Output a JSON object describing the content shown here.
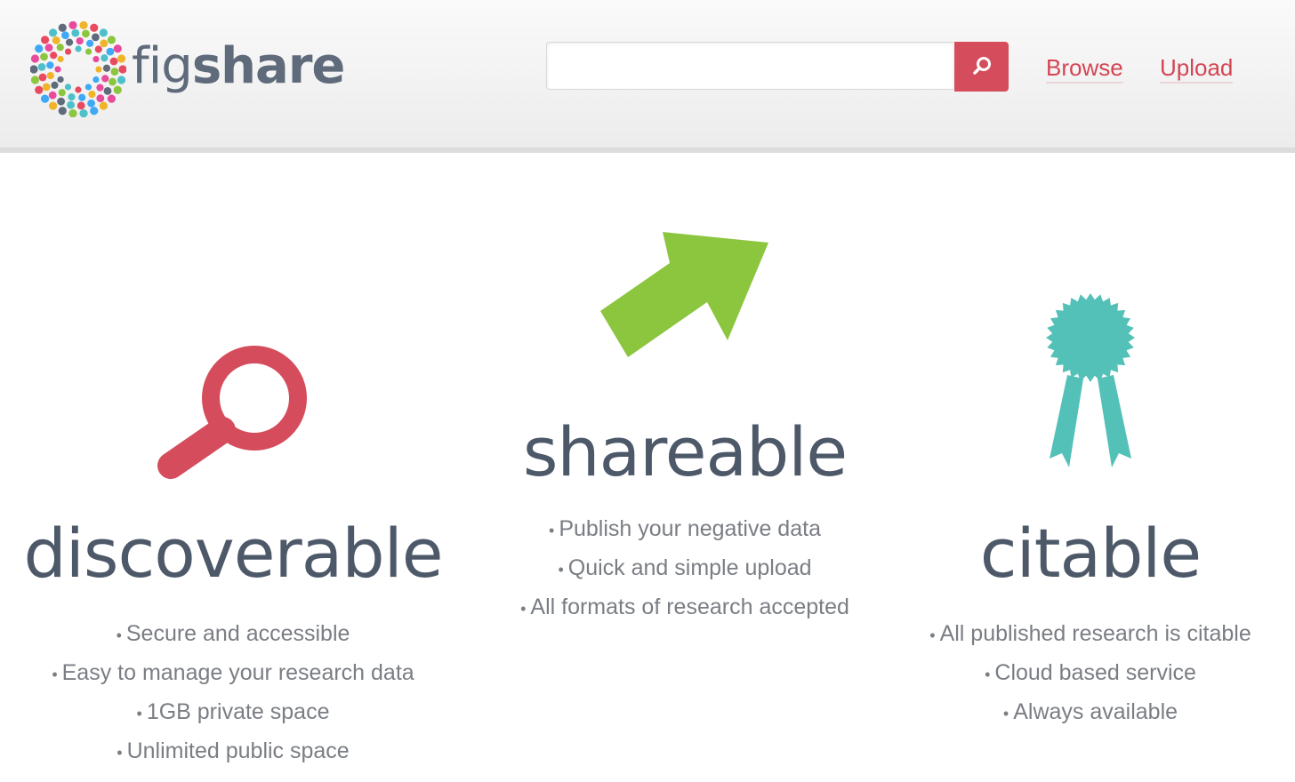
{
  "header": {
    "logo": {
      "text_light": "fig",
      "text_bold": "share"
    },
    "search": {
      "placeholder": "",
      "value": "",
      "button_icon": "search-icon"
    },
    "nav": [
      {
        "label": "Browse"
      },
      {
        "label": "Upload"
      }
    ]
  },
  "features": [
    {
      "heading": "discoverable",
      "icon": "magnifying-glass-icon",
      "bullets": [
        "Secure and accessible",
        "Easy to manage your research data",
        "1GB private space",
        "Unlimited public space"
      ]
    },
    {
      "heading": "shareable",
      "icon": "arrow-icon",
      "bullets": [
        "Publish your negative data",
        "Quick and simple upload",
        "All formats of research accepted"
      ]
    },
    {
      "heading": "citable",
      "icon": "award-ribbon-icon",
      "bullets": [
        "All published research is citable",
        "Cloud based service",
        "Always available"
      ]
    }
  ],
  "colors": {
    "accent_red": "#d54d5c",
    "arrow_green": "#8cc63f",
    "ribbon_teal": "#54c1b8",
    "heading_text": "#4d5969",
    "body_text": "#7a7e84"
  }
}
